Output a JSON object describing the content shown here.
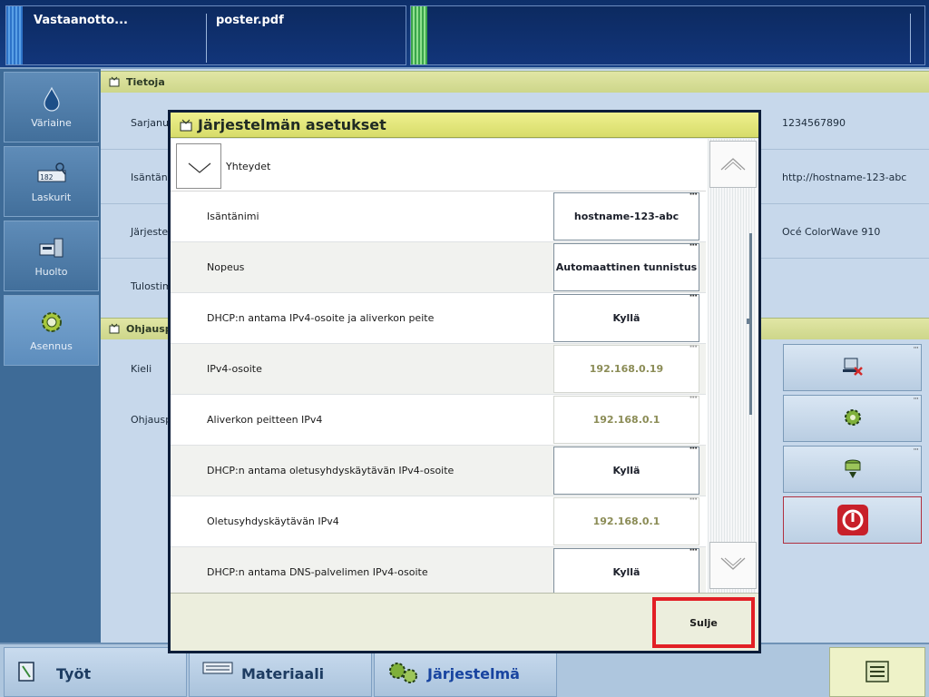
{
  "top_bar": {
    "job_queue_title": "Vastaanotto...",
    "job_file": "poster.pdf"
  },
  "sidebar": {
    "items": [
      {
        "label": "Väriaine",
        "icon": "toner-drop-icon"
      },
      {
        "label": "Laskurit",
        "icon": "counters-icon"
      },
      {
        "label": "Huolto",
        "icon": "maintenance-icon"
      },
      {
        "label": "Asennus",
        "icon": "setup-gear-icon",
        "active": true
      }
    ]
  },
  "background": {
    "info_section_title": "Tietoja",
    "info_labels": [
      "Sarjanu",
      "Isäntäni",
      "Järjeste",
      "Tulostim"
    ],
    "info_values": [
      "1234567890",
      "http://hostname-123-abc",
      "Océ ColorWave 910"
    ],
    "control_section_title": "Ohjausp",
    "control_labels": [
      "Kieli",
      "Ohjausp"
    ]
  },
  "dialog": {
    "title": "Järjestelmän asetukset",
    "section_label": "Yhteydet",
    "rows": [
      {
        "label": "Isäntänimi",
        "value": "hostname-123-abc",
        "editable": true
      },
      {
        "label": "Nopeus",
        "value": "Automaattinen tunnistus",
        "editable": true
      },
      {
        "label": "DHCP:n antama IPv4-osoite ja aliverkon peite",
        "value": "Kyllä",
        "editable": true
      },
      {
        "label": "IPv4-osoite",
        "value": "192.168.0.19",
        "editable": false
      },
      {
        "label": "Aliverkon peitteen IPv4",
        "value": "192.168.0.1",
        "editable": false
      },
      {
        "label": "DHCP:n antama oletusyhdyskäytävän IPv4-osoite",
        "value": "Kyllä",
        "editable": true
      },
      {
        "label": "Oletusyhdyskäytävän IPv4",
        "value": "192.168.0.1",
        "editable": false
      },
      {
        "label": "DHCP:n antama DNS-palvelimen IPv4-osoite",
        "value": "Kyllä",
        "editable": true
      }
    ],
    "close_label": "Sulje"
  },
  "bottom_bar": {
    "tabs": [
      {
        "label": "Työt",
        "icon": "jobs-icon"
      },
      {
        "label": "Materiaali",
        "icon": "media-icon"
      },
      {
        "label": "Järjestelmä",
        "icon": "system-gears-icon",
        "active": true
      }
    ],
    "menu_icon": "menu-list-icon"
  },
  "colors": {
    "dialog_title_bg": "#e4e87c",
    "highlight_red": "#e21f25",
    "readonly_value": "#8b8c56"
  }
}
